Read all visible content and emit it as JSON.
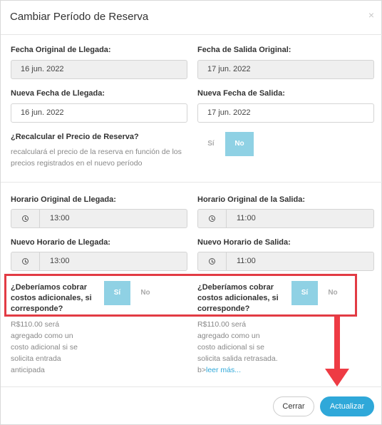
{
  "dialog": {
    "title": "Cambiar Período de Reserva",
    "close_glyph": "×"
  },
  "original_arrival": {
    "label": "Fecha Original de Llegada:",
    "value": "16 jun. 2022"
  },
  "original_departure": {
    "label": "Fecha de Salida Original:",
    "value": "17 jun. 2022"
  },
  "new_arrival": {
    "label": "Nueva Fecha de Llegada:",
    "value": "16 jun. 2022"
  },
  "new_departure": {
    "label": "Nueva Fecha de Salida:",
    "value": "17 jun. 2022"
  },
  "recalculate": {
    "label": "¿Recalcular el Precio de Reserva?",
    "help_line1": "recalculará el precio de la reserva en función de los",
    "help_line2": "precios registrados en el nuevo período",
    "yes": "Sí",
    "no": "No",
    "selected": "No"
  },
  "original_arrival_time": {
    "label": "Horario Original de Llegada:",
    "value": "13:00",
    "icon": "clock-icon"
  },
  "original_departure_time": {
    "label": "Horario Original de la Salida:",
    "value": "11:00",
    "icon": "clock-icon"
  },
  "new_arrival_time": {
    "label": "Nuevo Horario de Llegada:",
    "value": "13:00",
    "icon": "clock-icon"
  },
  "new_departure_time": {
    "label": "Nuevo Horario de Salida:",
    "value": "11:00",
    "icon": "clock-icon"
  },
  "extra_arrival": {
    "q1": "¿Deberíamos cobrar",
    "q2": "costos adicionales, si",
    "q3": "corresponde?",
    "yes": "Sí",
    "no": "No",
    "selected": "Sí",
    "h1": "R$110.00 será",
    "h2": "agregado como un",
    "h3": "costo adicional si se",
    "h4": "solicita entrada",
    "h5": "anticipada"
  },
  "extra_departure": {
    "q1": "¿Deberíamos cobrar",
    "q2": "costos adicionales, si",
    "q3": "corresponde?",
    "yes": "Sí",
    "no": "No",
    "selected": "Sí",
    "h1": "R$110.00 será",
    "h2": "agregado como un",
    "h3": "costo adicional si se",
    "h4": "solicita salida retrasada.",
    "h5_prefix": "b>",
    "h5_link": "leer más..."
  },
  "footer": {
    "close_label": "Cerrar",
    "update_label": "Actualizar"
  },
  "colors": {
    "accent": "#2fa8d9",
    "toggle_on": "#8fd1e4",
    "annotation_red": "#e23b44"
  }
}
